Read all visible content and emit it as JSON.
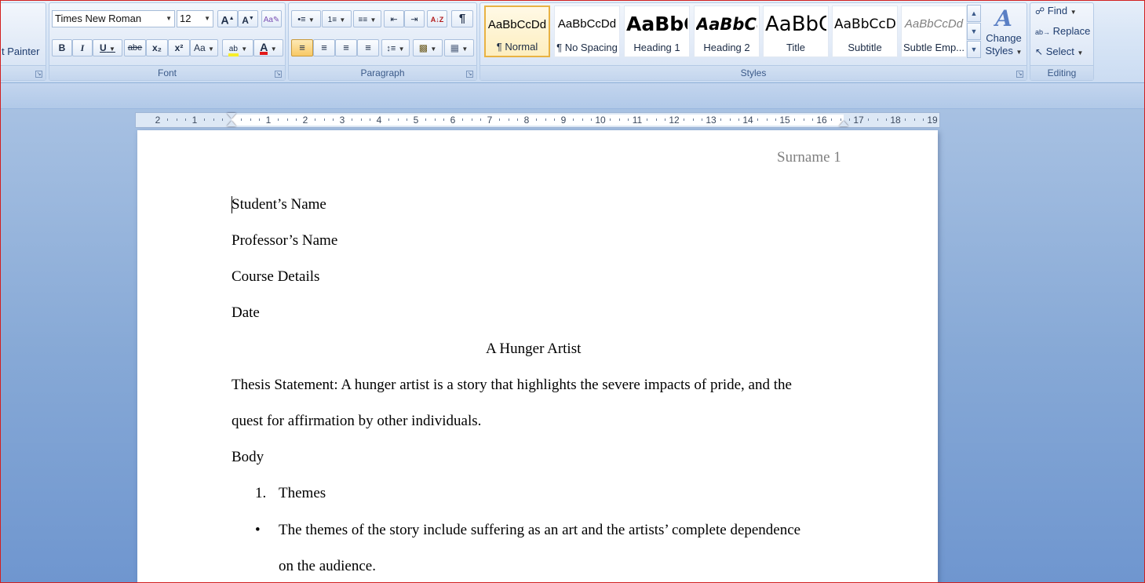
{
  "ribbon": {
    "clipboard": {
      "format_painter": "t Painter"
    },
    "font": {
      "label": "Font",
      "font_name": "Times New Roman",
      "font_size": "12",
      "grow": "A",
      "shrink": "A",
      "bold": "B",
      "italic": "I",
      "underline": "U",
      "strikethrough": "abe",
      "subscript": "x₂",
      "superscript": "x²",
      "change_case": "Aa",
      "highlight_color": "#f7ee2a",
      "font_color": "#e21a1a",
      "font_color_glyph": "A",
      "highlight_glyph": "ab"
    },
    "paragraph": {
      "label": "Paragraph",
      "pilcrow": "¶"
    },
    "styles": {
      "label": "Styles",
      "tiles": [
        {
          "sample": "AaBbCcDd",
          "name": "¶ Normal"
        },
        {
          "sample": "AaBbCcDd",
          "name": "¶ No Spacing"
        },
        {
          "sample": "AaBbC",
          "name": "Heading 1"
        },
        {
          "sample": "AaBbCc",
          "name": "Heading 2"
        },
        {
          "sample": "AaBbC",
          "name": "Title"
        },
        {
          "sample": "AaBbCcD",
          "name": "Subtitle"
        },
        {
          "sample": "AaBbCcDd",
          "name": "Subtle Emp..."
        }
      ],
      "change_styles_line1": "Change",
      "change_styles_line2": "Styles"
    },
    "editing": {
      "label": "Editing",
      "find": "Find",
      "replace": "Replace",
      "select": "Select"
    }
  },
  "ruler": {
    "left_numbers": [
      "2",
      "1"
    ],
    "right_numbers": [
      "1",
      "2",
      "3",
      "4",
      "5",
      "6",
      "7",
      "8",
      "9",
      "10",
      "11",
      "12",
      "13",
      "14",
      "15",
      "16",
      "17",
      "18",
      "19"
    ]
  },
  "document": {
    "header": "Surname 1",
    "lines": {
      "student": "Student’s Name",
      "professor": "Professor’s Name",
      "course": "Course Details",
      "date": "Date",
      "title": "A Hunger Artist",
      "thesis_1": "Thesis Statement: A hunger artist is a story that highlights the severe impacts of pride, and the",
      "thesis_2": "quest for affirmation by other individuals.",
      "body": "Body",
      "list_number": "1.",
      "list_item": "Themes",
      "bullet": "•",
      "bullet_1": "The themes of the story include suffering as an art and the artists’ complete dependence",
      "bullet_2": "on the audience."
    }
  },
  "colors": {
    "selected_tile_border": "#e8b243",
    "ribbon_label": "#3b5a89"
  }
}
